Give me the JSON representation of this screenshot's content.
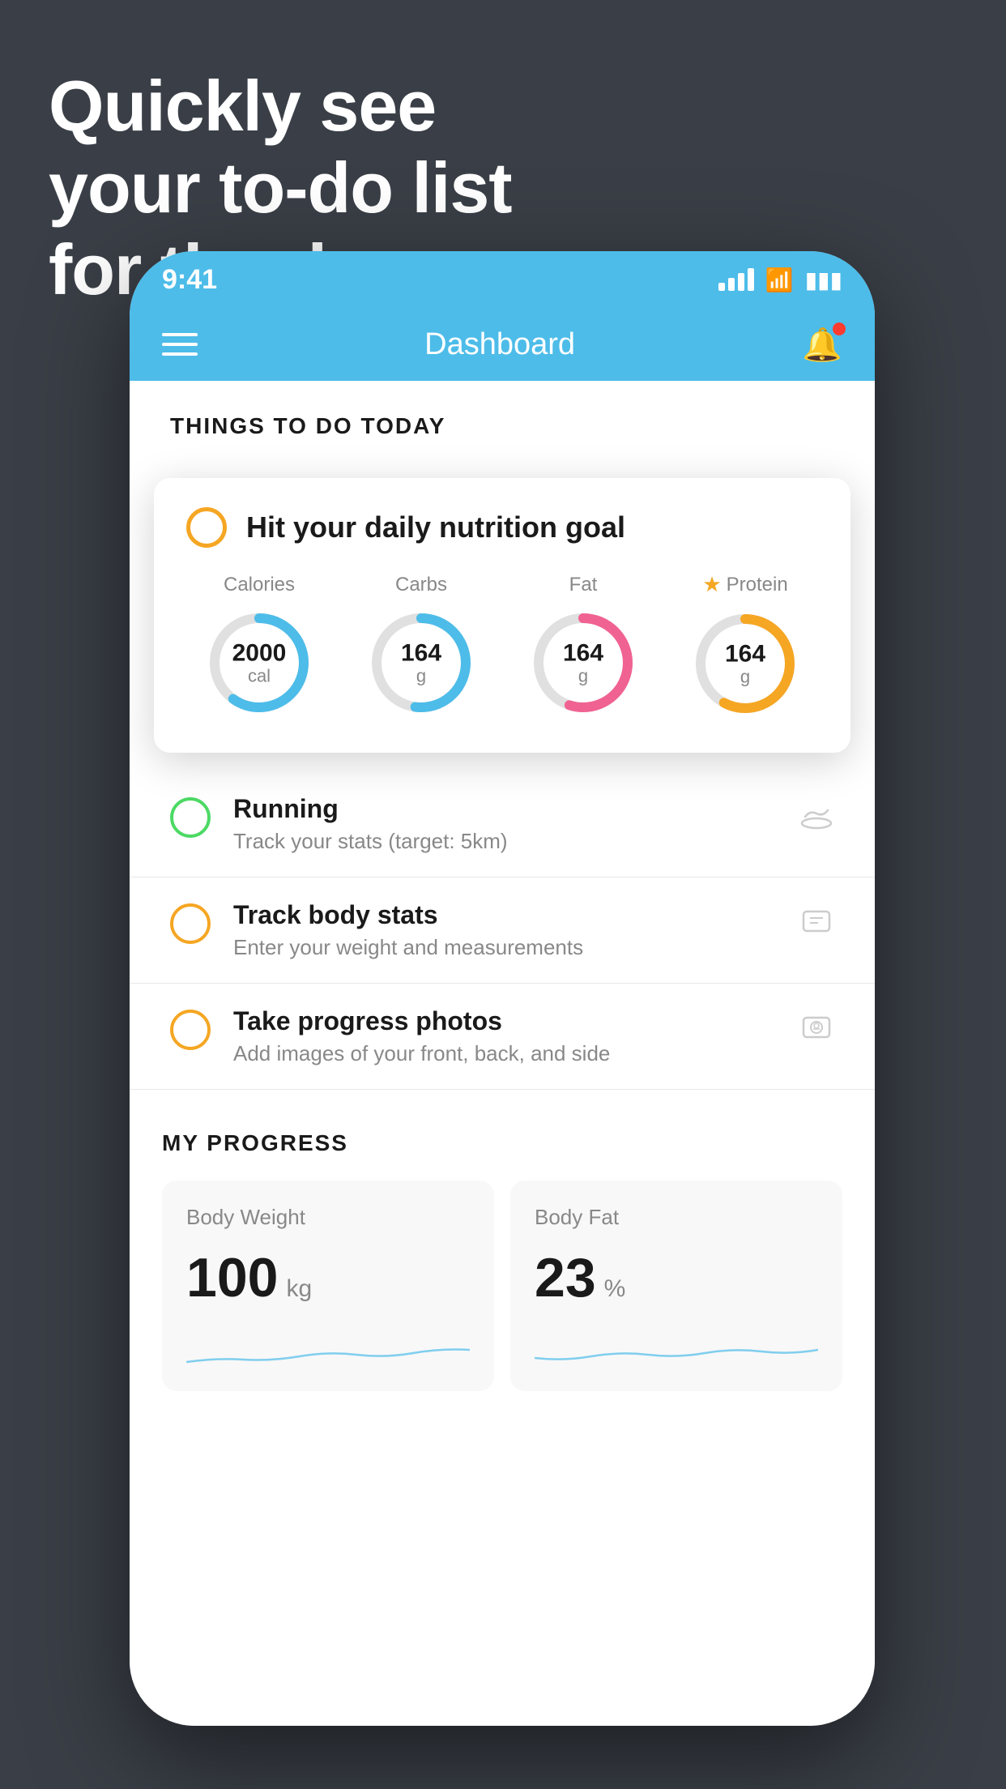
{
  "hero": {
    "line1": "Quickly see",
    "line2": "your to-do list",
    "line3": "for the day."
  },
  "status_bar": {
    "time": "9:41",
    "signal_label": "signal",
    "wifi_label": "wifi",
    "battery_label": "battery"
  },
  "nav": {
    "title": "Dashboard",
    "menu_label": "menu",
    "bell_label": "notifications"
  },
  "things_to_do": {
    "section_title": "THINGS TO DO TODAY"
  },
  "nutrition_card": {
    "title": "Hit your daily nutrition goal",
    "calories_label": "Calories",
    "calories_value": "2000",
    "calories_unit": "cal",
    "carbs_label": "Carbs",
    "carbs_value": "164",
    "carbs_unit": "g",
    "fat_label": "Fat",
    "fat_value": "164",
    "fat_unit": "g",
    "protein_label": "Protein",
    "protein_value": "164",
    "protein_unit": "g"
  },
  "todo_items": [
    {
      "name": "Running",
      "sub": "Track your stats (target: 5km)",
      "circle_type": "green",
      "icon": "👟"
    },
    {
      "name": "Track body stats",
      "sub": "Enter your weight and measurements",
      "circle_type": "yellow",
      "icon": "⊞"
    },
    {
      "name": "Take progress photos",
      "sub": "Add images of your front, back, and side",
      "circle_type": "yellow",
      "icon": "👤"
    }
  ],
  "progress": {
    "section_title": "MY PROGRESS",
    "body_weight": {
      "title": "Body Weight",
      "value": "100",
      "unit": "kg"
    },
    "body_fat": {
      "title": "Body Fat",
      "value": "23",
      "unit": "%"
    }
  }
}
